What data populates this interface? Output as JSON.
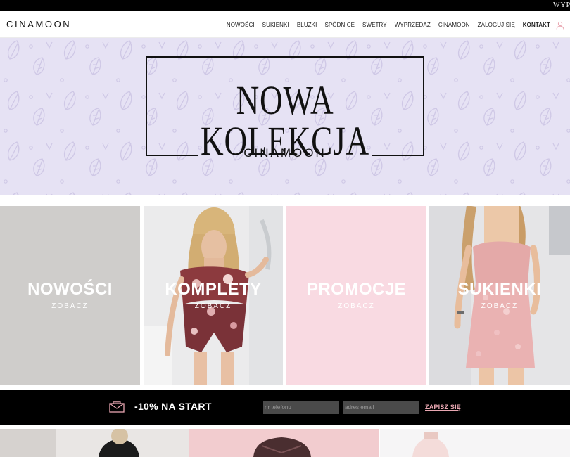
{
  "top_bar": {
    "marquee_text": "WYPR"
  },
  "header": {
    "logo": "CINAMOON",
    "nav": [
      {
        "label": "NOWOŚCI",
        "bold": false
      },
      {
        "label": "SUKIENKI",
        "bold": false
      },
      {
        "label": "BLUZKI",
        "bold": false
      },
      {
        "label": "SPÓDNICE",
        "bold": false
      },
      {
        "label": "SWETRY",
        "bold": false
      },
      {
        "label": "WYPRZEDAŻ",
        "bold": false
      },
      {
        "label": "CINAMOON",
        "bold": false
      },
      {
        "label": "ZALOGUJ SIĘ",
        "bold": false
      },
      {
        "label": "KONTAKT",
        "bold": true
      }
    ],
    "user_icon": "user-icon"
  },
  "hero": {
    "title": "NOWA KOLEKCJA",
    "subtitle": "CINAMOON",
    "bg_color": "#e6e2f4"
  },
  "tiles": [
    {
      "title": "NOWOŚCI",
      "link": "ZOBACZ",
      "bg": "#cfcdcb"
    },
    {
      "title": "KOMPLETY",
      "link": "ZOBACZ",
      "bg": "photo"
    },
    {
      "title": "PROMOCJE",
      "link": "ZOBACZ",
      "bg": "#f9dae2"
    },
    {
      "title": "SUKIENKI",
      "link": "ZOBACZ",
      "bg": "photo"
    }
  ],
  "newsletter": {
    "icon": "envelope-icon",
    "promo": "-10% NA START",
    "phone_placeholder": "nr telefonu",
    "email_placeholder": "adres email",
    "subscribe_label": "ZAPISZ SIĘ",
    "accent_color": "#e9a7b2"
  }
}
